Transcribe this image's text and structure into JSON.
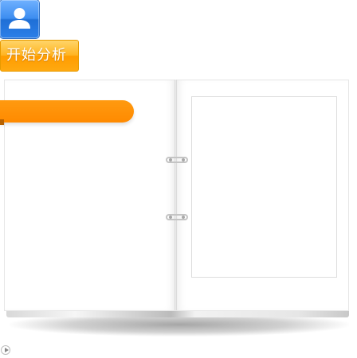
{
  "icons": {
    "user": "user-icon",
    "ring": "binder-ring-icon",
    "play": "play-icon"
  },
  "start_button": {
    "label": "开始分析"
  },
  "colors": {
    "accent_orange": "#ff8a00",
    "user_blue": "#3d8df0"
  }
}
